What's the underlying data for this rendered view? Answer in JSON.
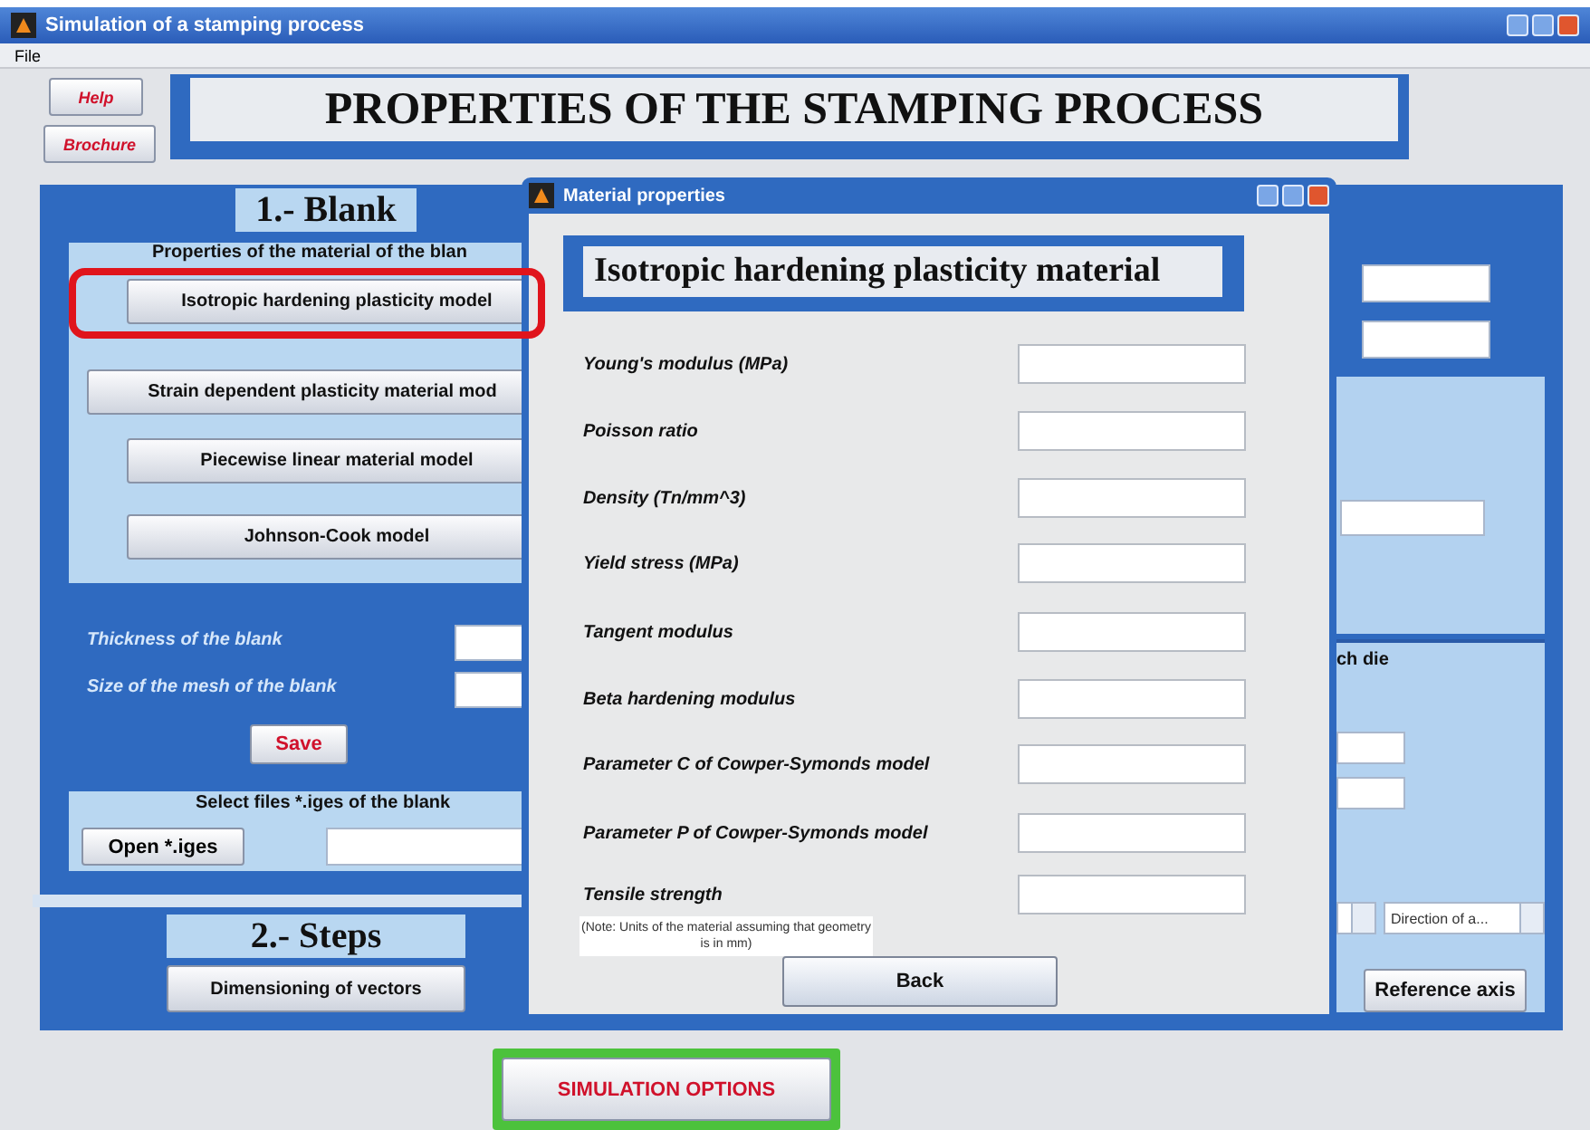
{
  "window": {
    "title": "Simulation of a stamping process",
    "menu": [
      "File"
    ]
  },
  "header": {
    "buttons": [
      "Help",
      "Brochure"
    ],
    "title": "PROPERTIES OF THE STAMPING PROCESS"
  },
  "blank": {
    "heading": "1.- Blank",
    "material_label": "Properties of the material of the blan",
    "models": [
      {
        "label": "Isotropic hardening plasticity model",
        "highlighted": true
      },
      {
        "label": "Strain dependent plasticity material mod",
        "highlighted": false
      },
      {
        "label": "Piecewise linear material model",
        "highlighted": false
      },
      {
        "label": "Johnson-Cook model",
        "highlighted": false
      }
    ],
    "fields": [
      {
        "label": "Thickness of the blank"
      },
      {
        "label": "Size of the mesh of the blank"
      }
    ],
    "save_button": "Save",
    "files_label": "Select files *.iges of the blank",
    "open_button": "Open *.iges"
  },
  "steps": {
    "heading": "2.- Steps",
    "button": "Dimensioning of vectors"
  },
  "right_panel": {
    "label": "ch die",
    "direction_dropdown": "Direction of a...",
    "reference_button": "Reference axis"
  },
  "simulation_button": {
    "label": "SIMULATION OPTIONS",
    "highlighted": true
  },
  "dialog": {
    "title": "Material properties",
    "heading": "Isotropic hardening plasticity material",
    "fields": [
      {
        "label": "Young's modulus (MPa)"
      },
      {
        "label": "Poisson ratio"
      },
      {
        "label": "Density (Tn/mm^3)"
      },
      {
        "label": "Yield stress (MPa)"
      },
      {
        "label": "Tangent modulus"
      },
      {
        "label": "Beta hardening modulus"
      },
      {
        "label": "Parameter C of Cowper-Symonds model"
      },
      {
        "label": "Parameter P of Cowper-Symonds model"
      },
      {
        "label": "Tensile strength"
      }
    ],
    "note": "(Note: Units of the material assuming that geometry is in mm)",
    "back_button": "Back"
  }
}
